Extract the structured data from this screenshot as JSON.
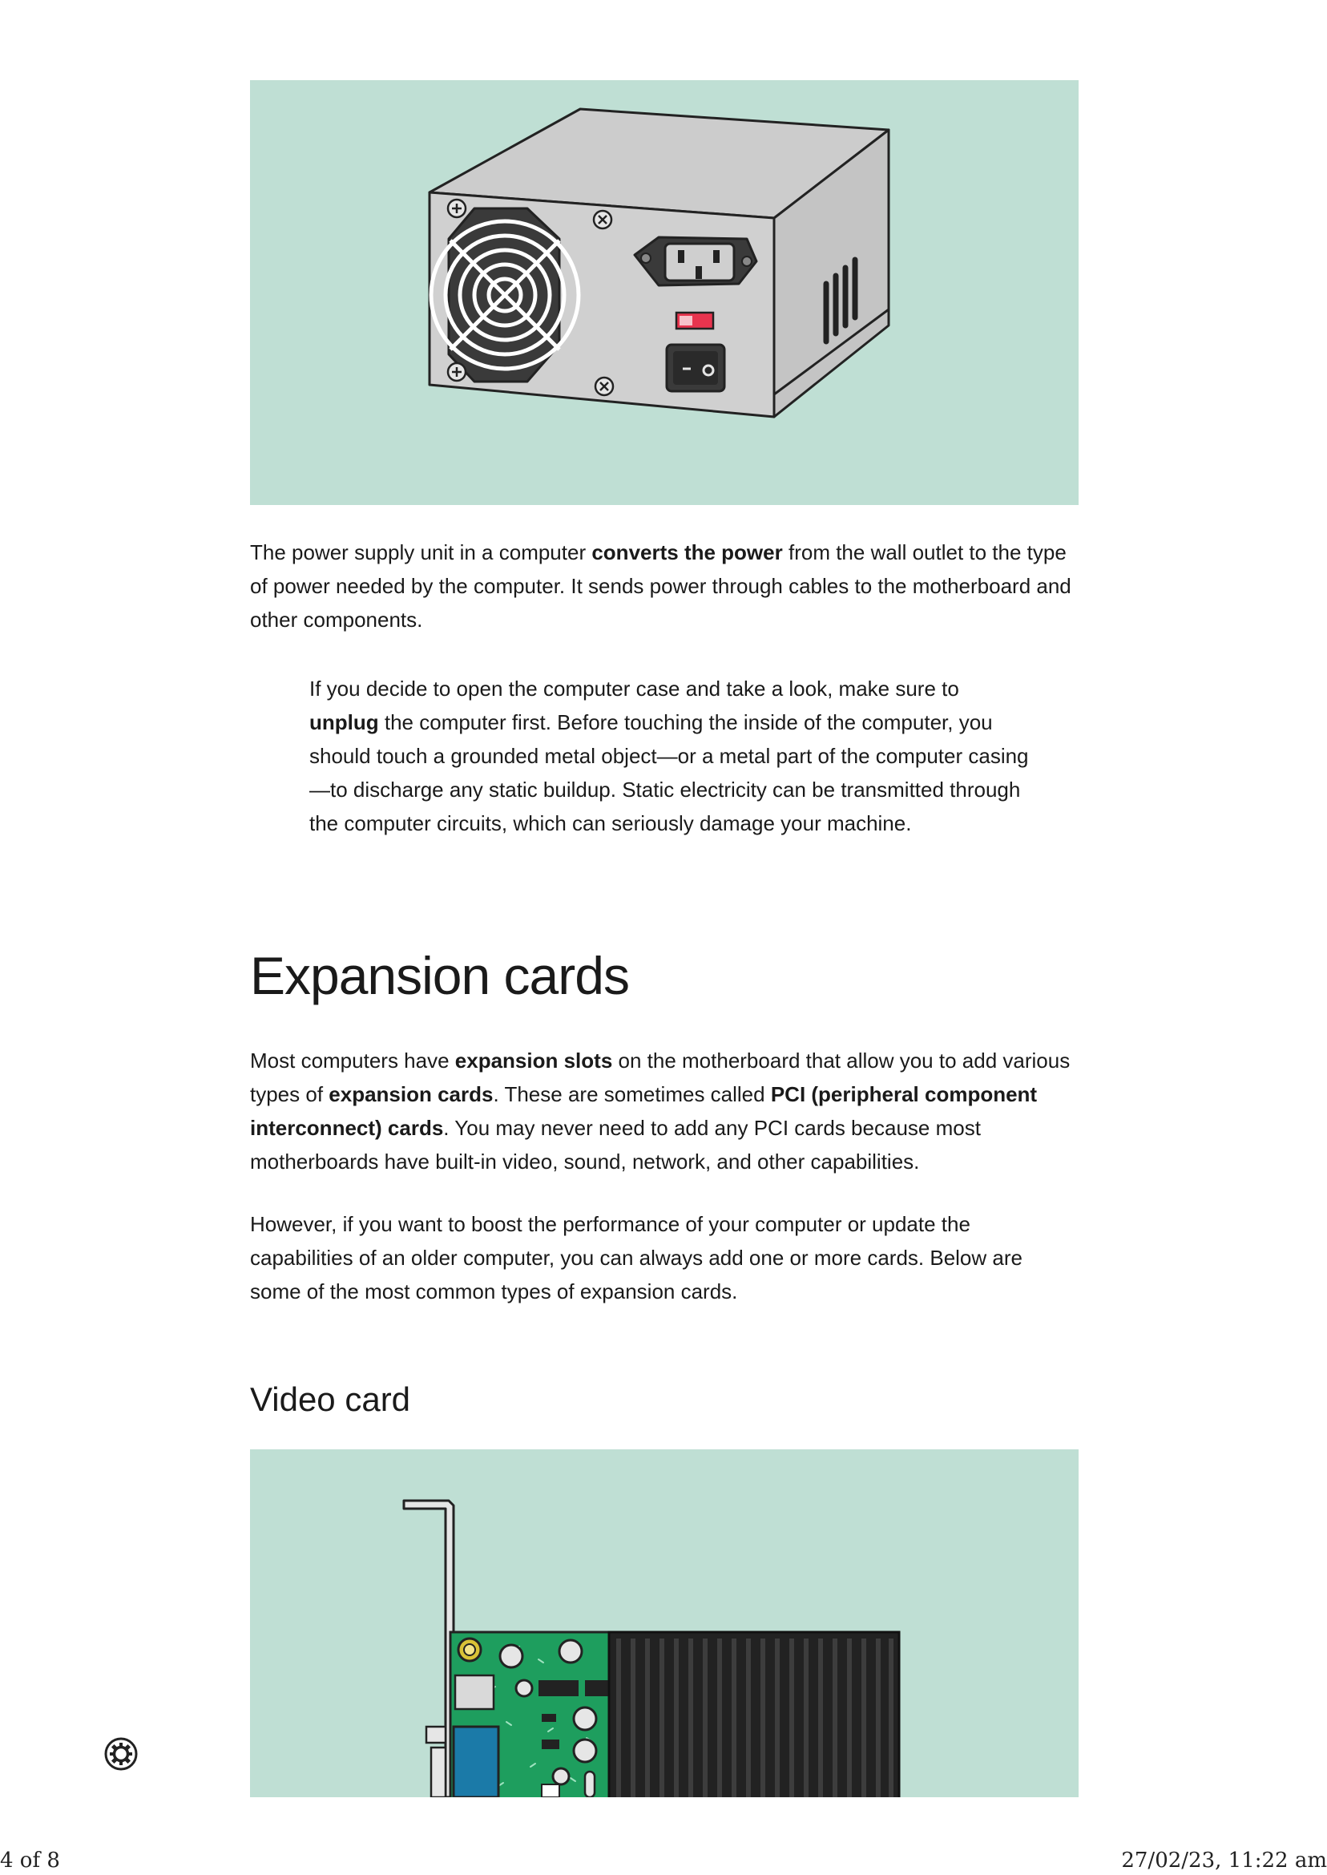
{
  "content": {
    "psu_paragraph": {
      "t1": "The power supply unit in a computer ",
      "b1": "converts the power",
      "t2": " from the wall outlet to the type of power needed by the computer. It sends power through cables to the motherboard and other components."
    },
    "note": {
      "t1": "If you decide to open the computer case and take a look, make sure to ",
      "b1": "unplug",
      "t2": " the computer first. Before touching the inside of the computer, you should touch a grounded metal object—or a metal part of the computer casing—to discharge any static buildup. Static electricity can be transmitted through the computer circuits, which can seriously damage your machine."
    },
    "expansion_heading": "Expansion cards",
    "expansion_p1": {
      "t1": "Most computers have ",
      "b1": "expansion slots",
      "t2": " on the motherboard that allow you to add various types of ",
      "b2": "expansion cards",
      "t3": ". These are sometimes called ",
      "b3": "PCI (peripheral component interconnect) cards",
      "t4": ". You may never need to add any PCI cards because most motherboards have built-in video, sound, network, and other capabilities."
    },
    "expansion_p2": "However, if you want to boost the performance of your computer or update the capabilities of an older computer, you can always add one or more cards. Below are some of the most common types of expansion cards.",
    "video_heading": "Video card"
  },
  "footer": {
    "page": "4 of 8",
    "datetime": "27/02/23, 11:22 am"
  },
  "icons": {
    "settings": "gear-icon"
  },
  "colors": {
    "figure_bg": "#bfdfd4",
    "case": "#cccccc",
    "pcb": "#1e9e5e",
    "heatsink": "#222222",
    "switch_red": "#e8344e"
  }
}
